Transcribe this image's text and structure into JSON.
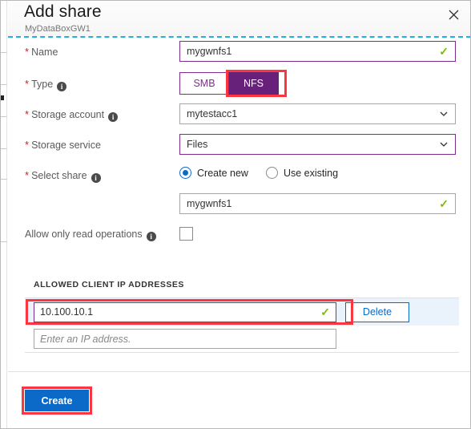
{
  "header": {
    "title": "Add share",
    "subtitle": "MyDataBoxGW1",
    "close_icon": "close-icon"
  },
  "fields": {
    "name": {
      "label": "Name",
      "required": true,
      "value": "mygwnfs1",
      "valid_icon": "✓"
    },
    "type": {
      "label": "Type",
      "required": true,
      "has_info": true,
      "options": [
        "SMB",
        "NFS"
      ],
      "selected": "NFS"
    },
    "storage_account": {
      "label": "Storage account",
      "required": true,
      "has_info": true,
      "value": "mytestacc1"
    },
    "storage_service": {
      "label": "Storage service",
      "required": true,
      "value": "Files"
    },
    "select_share": {
      "label": "Select share",
      "required": true,
      "has_info": true,
      "options": [
        "Create new",
        "Use existing"
      ],
      "selected": "Create new",
      "share_name_value": "mygwnfs1",
      "valid_icon": "✓"
    },
    "read_only": {
      "label": "Allow only read operations",
      "required": false,
      "has_info": true,
      "checked": false
    }
  },
  "ip_section": {
    "title": "ALLOWED CLIENT IP ADDRESSES",
    "rows": [
      {
        "value": "10.100.10.1",
        "valid_icon": "✓",
        "delete_label": "Delete",
        "selected": true
      }
    ],
    "new_row_placeholder": "Enter an IP address."
  },
  "footer": {
    "create_label": "Create"
  },
  "colors": {
    "accent_blue": "#0b6ac8",
    "purple": "#68217a",
    "purple_border": "#7d2d8f",
    "highlight_red": "#fb3640",
    "valid_green": "#7fba00",
    "required_red": "#e81123",
    "dashed_teal": "#22b2d6",
    "selected_row_blue": "#eaf3fb"
  }
}
